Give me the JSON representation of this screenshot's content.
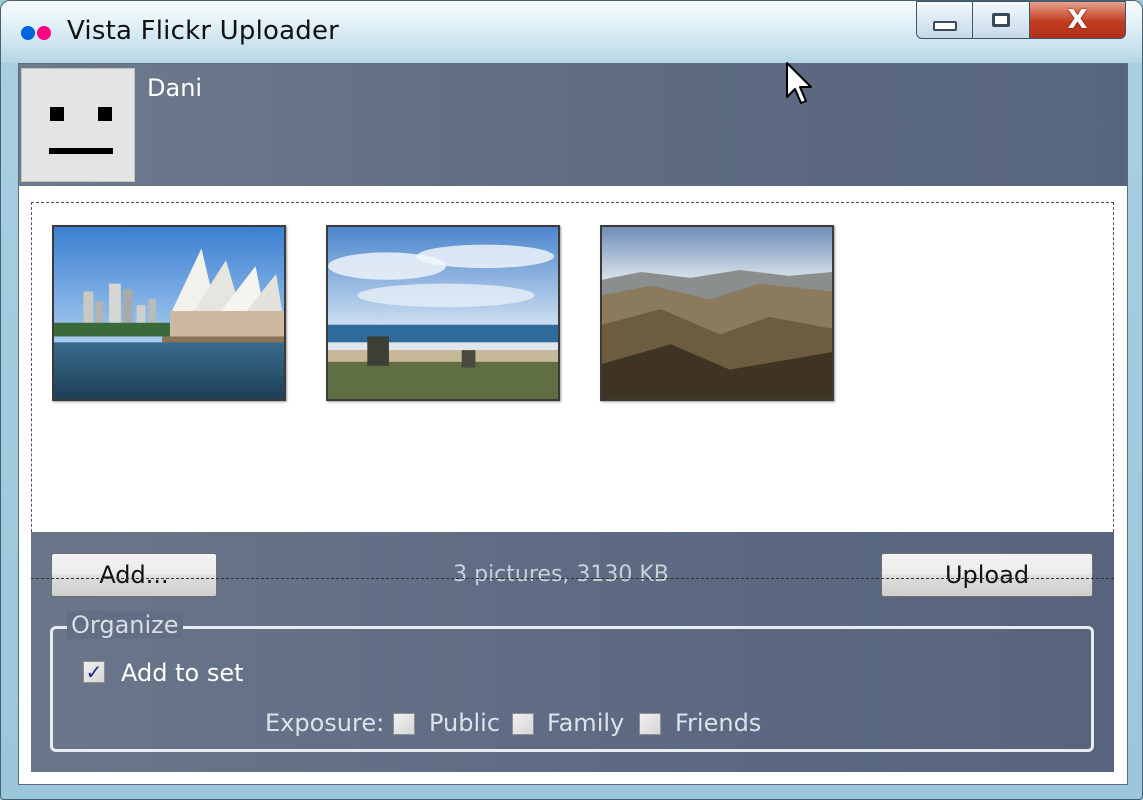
{
  "window": {
    "title": "Vista Flickr Uploader",
    "logo_colors": [
      "#0063dc",
      "#ff0084"
    ],
    "controls": {
      "minimize_icon": "minimize-icon",
      "maximize_icon": "maximize-icon",
      "close_icon": "close-icon",
      "close_glyph": "X"
    }
  },
  "user": {
    "name": "Dani",
    "avatar_icon": "buddy-icon"
  },
  "photos": [
    {
      "subject": "opera-house-harbour"
    },
    {
      "subject": "beach-sky"
    },
    {
      "subject": "mountain-valley"
    }
  ],
  "actions": {
    "add_label": "Add...",
    "upload_label": "Upload",
    "summary": "3 pictures, 3130 KB"
  },
  "organize": {
    "title": "Organize",
    "add_to_set": {
      "label": "Add to set",
      "checked": true
    },
    "exposure_label": "Exposure:",
    "exposure_options": [
      {
        "label": "Public",
        "checked": false
      },
      {
        "label": "Family",
        "checked": false
      },
      {
        "label": "Friends",
        "checked": false
      }
    ]
  }
}
